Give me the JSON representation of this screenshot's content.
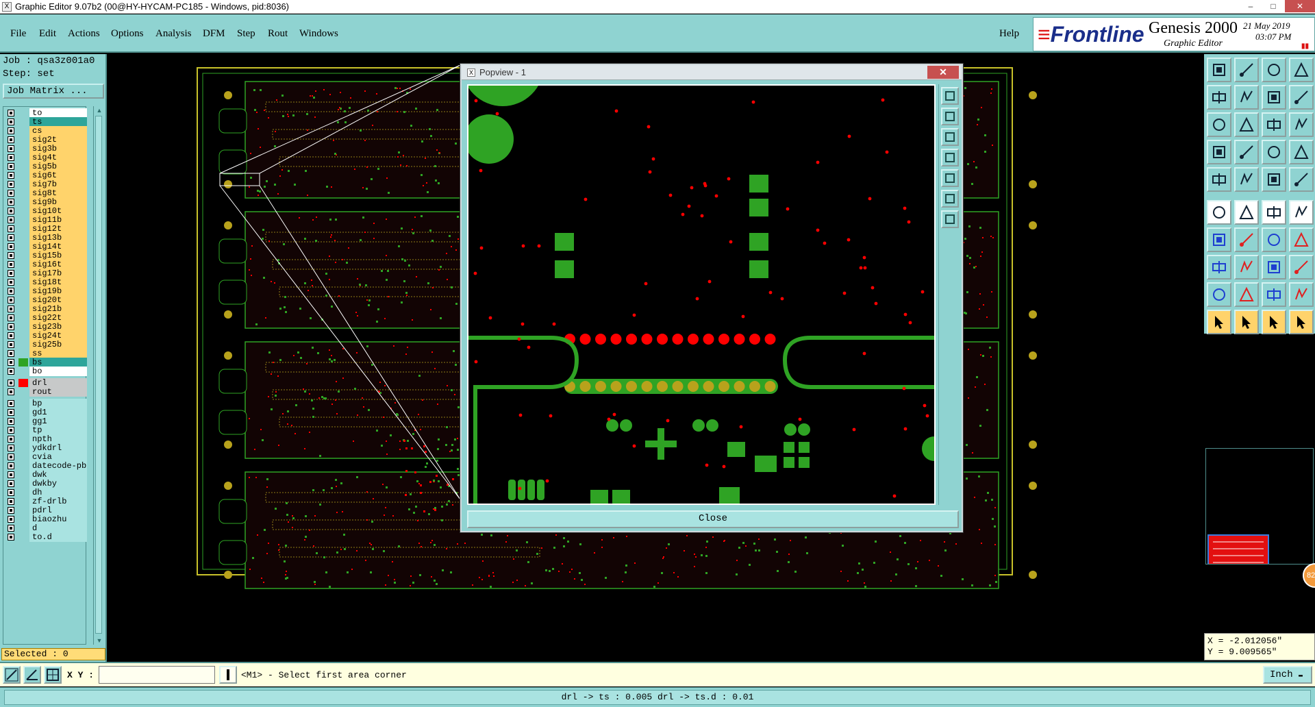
{
  "window": {
    "title": "Graphic Editor 9.07b2 (00@HY-HYCAM-PC185 - Windows, pid:8036)",
    "controls": [
      "–",
      "□",
      "✕"
    ]
  },
  "menu": {
    "items": [
      "File",
      "Edit",
      "Actions",
      "Options",
      "Analysis",
      "DFM",
      "Step",
      "Rout",
      "Windows"
    ],
    "help": "Help"
  },
  "brand": {
    "logo": "Frontline",
    "product": "Genesis 2000",
    "subtitle": "Graphic Editor",
    "date": "21 May 2019",
    "time": "03:07 PM"
  },
  "job": {
    "job_line": "Job : qsa3z001a0",
    "step_line": "Step: set",
    "job_matrix": "Job Matrix ..."
  },
  "layers": [
    {
      "name": "to",
      "color": "#ffffff",
      "swatch": ""
    },
    {
      "name": "ts",
      "color": "#2ea59a",
      "swatch": ""
    },
    {
      "name": "cs",
      "color": "#ffd36b",
      "swatch": ""
    },
    {
      "name": "sig2t",
      "color": "#ffd36b",
      "swatch": ""
    },
    {
      "name": "sig3b",
      "color": "#ffd36b",
      "swatch": ""
    },
    {
      "name": "sig4t",
      "color": "#ffd36b",
      "swatch": ""
    },
    {
      "name": "sig5b",
      "color": "#ffd36b",
      "swatch": ""
    },
    {
      "name": "sig6t",
      "color": "#ffd36b",
      "swatch": ""
    },
    {
      "name": "sig7b",
      "color": "#ffd36b",
      "swatch": ""
    },
    {
      "name": "sig8t",
      "color": "#ffd36b",
      "swatch": ""
    },
    {
      "name": "sig9b",
      "color": "#ffd36b",
      "swatch": ""
    },
    {
      "name": "sig10t",
      "color": "#ffd36b",
      "swatch": ""
    },
    {
      "name": "sig11b",
      "color": "#ffd36b",
      "swatch": ""
    },
    {
      "name": "sig12t",
      "color": "#ffd36b",
      "swatch": ""
    },
    {
      "name": "sig13b",
      "color": "#ffd36b",
      "swatch": ""
    },
    {
      "name": "sig14t",
      "color": "#ffd36b",
      "swatch": ""
    },
    {
      "name": "sig15b",
      "color": "#ffd36b",
      "swatch": ""
    },
    {
      "name": "sig16t",
      "color": "#ffd36b",
      "swatch": ""
    },
    {
      "name": "sig17b",
      "color": "#ffd36b",
      "swatch": ""
    },
    {
      "name": "sig18t",
      "color": "#ffd36b",
      "swatch": ""
    },
    {
      "name": "sig19b",
      "color": "#ffd36b",
      "swatch": ""
    },
    {
      "name": "sig20t",
      "color": "#ffd36b",
      "swatch": ""
    },
    {
      "name": "sig21b",
      "color": "#ffd36b",
      "swatch": ""
    },
    {
      "name": "sig22t",
      "color": "#ffd36b",
      "swatch": ""
    },
    {
      "name": "sig23b",
      "color": "#ffd36b",
      "swatch": ""
    },
    {
      "name": "sig24t",
      "color": "#ffd36b",
      "swatch": ""
    },
    {
      "name": "sig25b",
      "color": "#ffd36b",
      "swatch": ""
    },
    {
      "name": "ss",
      "color": "#ffd36b",
      "swatch": ""
    },
    {
      "name": "bs",
      "color": "#2ea59a",
      "swatch": "#2fa324"
    },
    {
      "name": "bo",
      "color": "#ffffff",
      "swatch": ""
    },
    {
      "name": "drl",
      "color": "#c7c9c9",
      "swatch": "#ff0000"
    },
    {
      "name": "rout",
      "color": "#c7c9c9",
      "swatch": ""
    },
    {
      "name": "bp",
      "color": "#a9e3e1",
      "swatch": ""
    },
    {
      "name": "gd1",
      "color": "#a9e3e1",
      "swatch": ""
    },
    {
      "name": "gg1",
      "color": "#a9e3e1",
      "swatch": ""
    },
    {
      "name": "tp",
      "color": "#a9e3e1",
      "swatch": ""
    },
    {
      "name": "npth",
      "color": "#a9e3e1",
      "swatch": ""
    },
    {
      "name": "ydkdrl",
      "color": "#a9e3e1",
      "swatch": ""
    },
    {
      "name": "cvia",
      "color": "#a9e3e1",
      "swatch": ""
    },
    {
      "name": "datecode-pb",
      "color": "#a9e3e1",
      "swatch": ""
    },
    {
      "name": "dwk",
      "color": "#a9e3e1",
      "swatch": ""
    },
    {
      "name": "dwkby",
      "color": "#a9e3e1",
      "swatch": ""
    },
    {
      "name": "dh",
      "color": "#a9e3e1",
      "swatch": ""
    },
    {
      "name": "zf-drlb",
      "color": "#a9e3e1",
      "swatch": ""
    },
    {
      "name": "pdrl",
      "color": "#a9e3e1",
      "swatch": ""
    },
    {
      "name": "biaozhu",
      "color": "#a9e3e1",
      "swatch": ""
    },
    {
      "name": "d",
      "color": "#a9e3e1",
      "swatch": ""
    },
    {
      "name": "to.d",
      "color": "#a9e3e1",
      "swatch": ""
    }
  ],
  "selected": "Selected : 0",
  "popview": {
    "title": "Popview - 1",
    "close_x": "✕",
    "close_button": "Close"
  },
  "coords": {
    "x": "X = -2.012056\"",
    "y": "Y = 9.009565\""
  },
  "badge": "82",
  "command": {
    "xy_label": "X Y :",
    "xy_value": "",
    "prompt": "<M1> - Select first area corner",
    "unit": "Inch"
  },
  "status": "drl -> ts : 0.005   drl -> ts.d : 0.01",
  "colors": {
    "panel": "#8fd3d1",
    "board_copper": "#2fa324",
    "drill": "#ff0000",
    "pad_yellow": "#b8a21c"
  },
  "toolbox_icons": [
    "zoom-home-icon",
    "zoom-in-icon",
    "zoom-out-icon",
    "window-icon",
    "pan-left-icon",
    "pan-right-icon",
    "fit-icon",
    "redraw-icon",
    "zoom-fit-icon",
    "zoom-area-icon",
    "ratio-icon",
    "query-icon",
    "snap-icon",
    "grid-icon",
    "layer-compare-icon",
    "layer-stack-icon",
    "feature-select-icon",
    "net-select-icon",
    "ruler-icon",
    "pad-icon",
    "connect-icon",
    "cross-icon",
    "route-icon",
    "diagonal-icon",
    "line-red-icon",
    "line-blue-icon",
    "arc-icon",
    "measure-icon",
    "polygon-icon",
    "hline-icon",
    "box-icon",
    "shapes-icon",
    "triangle-icon",
    "a-letter-icon",
    "arch-icon",
    "surface-icon",
    "pointer-icon",
    "pointer-red-icon",
    "pointer-select-icon",
    "pointer-multi-icon"
  ]
}
